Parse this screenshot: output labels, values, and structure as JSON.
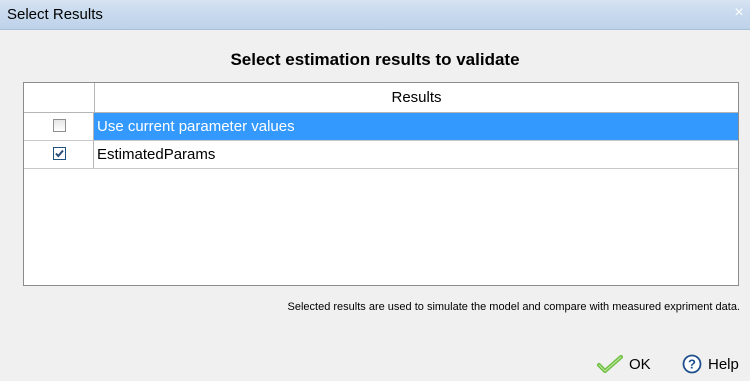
{
  "window": {
    "title": "Select Results",
    "close_glyph": "×"
  },
  "heading": "Select estimation results to validate",
  "table": {
    "header": {
      "results_label": "Results"
    },
    "rows": [
      {
        "label": "Use current parameter values",
        "checked": false,
        "selected": true
      },
      {
        "label": "EstimatedParams",
        "checked": true,
        "selected": false
      }
    ]
  },
  "footnote": "Selected results are used to simulate the model and compare with measured expriment data.",
  "buttons": {
    "ok_label": "OK",
    "help_label": "Help"
  },
  "colors": {
    "selection": "#3399ff",
    "ok_icon": "#6cbf3f",
    "help_icon": "#1f4e8c"
  },
  "icons": {
    "ok": "checkmark-icon",
    "help": "question-circle-icon"
  }
}
